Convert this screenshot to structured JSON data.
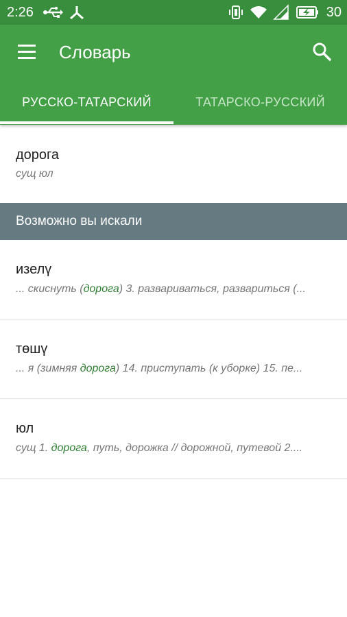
{
  "status_bar": {
    "time": "2:26",
    "battery_percent": "30"
  },
  "app_bar": {
    "title": "Словарь",
    "tabs": [
      {
        "label": "РУССКО-ТАТАРСКИЙ",
        "active": true
      },
      {
        "label": "ТАТАРСКО-РУССКИЙ",
        "active": false
      }
    ]
  },
  "entry": {
    "word": "дорога",
    "grammar": "сущ юл"
  },
  "suggestions_header": "Возможно вы искали",
  "suggestions": [
    {
      "word": "изелү",
      "pre": "... скиснуть (",
      "highlight": "дорога",
      "post": ") 3. развариваться, развариться (..."
    },
    {
      "word": "төшү",
      "pre": "... я (зимняя ",
      "highlight": "дорога",
      "post": ") 14. приступать (к уборке) 15. пе..."
    },
    {
      "word": "юл",
      "pre": "сущ 1. ",
      "highlight": "дорога",
      "post": ", путь, дорожка // дорожной, путевой 2...."
    }
  ],
  "colors": {
    "status_bar": "#388e3c",
    "app_bar": "#43a047",
    "section_header": "#667a82",
    "highlight": "#2e7d32"
  },
  "icons": [
    "usb-icon",
    "share-icon",
    "vibrate-icon",
    "wifi-icon",
    "signal-icon",
    "battery-charging-icon",
    "menu-icon",
    "search-icon"
  ]
}
